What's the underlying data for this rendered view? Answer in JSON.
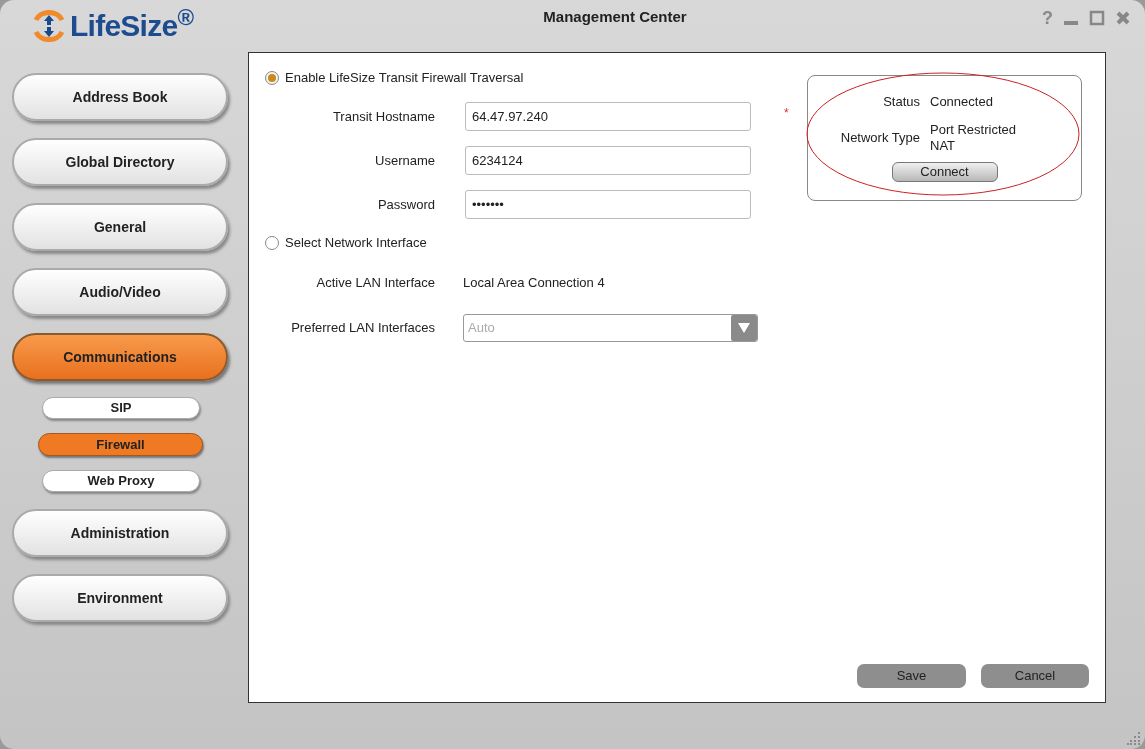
{
  "window": {
    "title": "Management Center",
    "help": "?"
  },
  "logo": {
    "text": "LifeSize$^{®}$"
  },
  "sidebar": {
    "items": [
      {
        "label": "Address Book",
        "selected": false
      },
      {
        "label": "Global Directory",
        "selected": false
      },
      {
        "label": "General",
        "selected": false
      },
      {
        "label": "Audio/Video",
        "selected": false
      },
      {
        "label": "Communications",
        "selected": true,
        "children": [
          {
            "label": "SIP",
            "selected": false
          },
          {
            "label": "Firewall",
            "selected": true
          },
          {
            "label": "Web Proxy",
            "selected": false
          }
        ]
      },
      {
        "label": "Administration",
        "selected": false
      },
      {
        "label": "Environment",
        "selected": false
      }
    ]
  },
  "firewall": {
    "traversal_option": {
      "label": "Enable LifeSize Transit Firewall Traversal",
      "selected": true
    },
    "fields": [
      {
        "label": "Transit Hostname",
        "value": "64.47.97.240",
        "required_mark": "*"
      },
      {
        "label": "Username",
        "value": "6234124"
      },
      {
        "label": "Password",
        "value": "•••••••"
      }
    ],
    "interface_option": {
      "label": "Select Network Interface",
      "selected": false
    },
    "active_lan": {
      "label": "Active LAN Interface",
      "value": "Local Area Connection 4"
    },
    "preferred_lan": {
      "label": "Preferred LAN Interfaces",
      "value": "Auto",
      "disabled": true
    },
    "status_box": {
      "rows": [
        {
          "label": "Status",
          "value": "Connected"
        },
        {
          "label": "Network Type",
          "value": "Port Restricted NAT"
        }
      ],
      "button": "Connect"
    },
    "buttons": [
      "Save",
      "Cancel"
    ]
  }
}
